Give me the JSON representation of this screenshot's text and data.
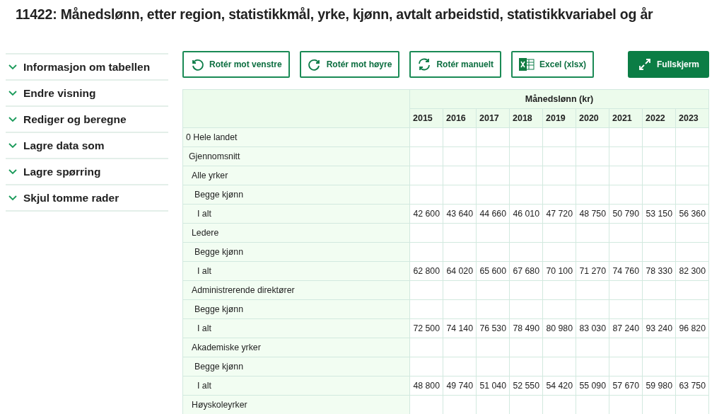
{
  "title": "11422: Månedslønn, etter region, statistikkmål, yrke, kjønn, avtalt arbeidstid, statistikkvariabel og år",
  "sidebar": {
    "items": [
      {
        "label": "Informasjon om tabellen",
        "expanded": false
      },
      {
        "label": "Endre visning",
        "expanded": false
      },
      {
        "label": "Rediger og beregne",
        "expanded": false
      },
      {
        "label": "Lagre data som",
        "expanded": false
      },
      {
        "label": "Lagre spørring",
        "expanded": false
      },
      {
        "label": "Skjul tomme rader",
        "expanded": false
      }
    ]
  },
  "toolbar": [
    {
      "label": "Rotér mot venstre",
      "kind": "rotate-left",
      "primary": false
    },
    {
      "label": "Rotér mot høyre",
      "kind": "rotate-right",
      "primary": false
    },
    {
      "label": "Rotér manuelt",
      "kind": "rotate-both",
      "primary": false
    },
    {
      "label": "Excel (xlsx)",
      "kind": "excel",
      "primary": false
    },
    {
      "label": "Fullskjerm",
      "kind": "expand",
      "primary": true
    }
  ],
  "table": {
    "header": "Månedslønn (kr)",
    "columns": [
      "2015",
      "2016",
      "2017",
      "2018",
      "2019",
      "2020",
      "2021",
      "2022",
      "2023"
    ],
    "rows": [
      {
        "label": "0 Hele landet",
        "children": [
          {
            "label": "Gjennomsnitt",
            "children": [
              {
                "label": "Alle yrker",
                "children": [
                  {
                    "label": "Begge kjønn",
                    "children": [
                      {
                        "label": "I alt",
                        "values": [
                          "42 600",
                          "43 640",
                          "44 660",
                          "46 010",
                          "47 720",
                          "48 750",
                          "50 790",
                          "53 150",
                          "56 360"
                        ]
                      }
                    ]
                  }
                ]
              },
              {
                "label": "Ledere",
                "children": [
                  {
                    "label": "Begge kjønn",
                    "children": [
                      {
                        "label": "I alt",
                        "values": [
                          "62 800",
                          "64 020",
                          "65 600",
                          "67 680",
                          "70 100",
                          "71 270",
                          "74 760",
                          "78 330",
                          "82 300"
                        ]
                      }
                    ]
                  }
                ]
              },
              {
                "label": "Administrerende direktører",
                "children": [
                  {
                    "label": "Begge kjønn",
                    "children": [
                      {
                        "label": "I alt",
                        "values": [
                          "72 500",
                          "74 140",
                          "76 530",
                          "78 490",
                          "80 980",
                          "83 030",
                          "87 240",
                          "93 240",
                          "96 820"
                        ]
                      }
                    ]
                  }
                ]
              },
              {
                "label": "Akademiske yrker",
                "children": [
                  {
                    "label": "Begge kjønn",
                    "children": [
                      {
                        "label": "I alt",
                        "values": [
                          "48 800",
                          "49 740",
                          "51 040",
                          "52 550",
                          "54 420",
                          "55 090",
                          "57 670",
                          "59 980",
                          "63 750"
                        ]
                      }
                    ]
                  }
                ]
              },
              {
                "label": "Høyskoleyrker"
              }
            ]
          }
        ]
      }
    ]
  }
}
